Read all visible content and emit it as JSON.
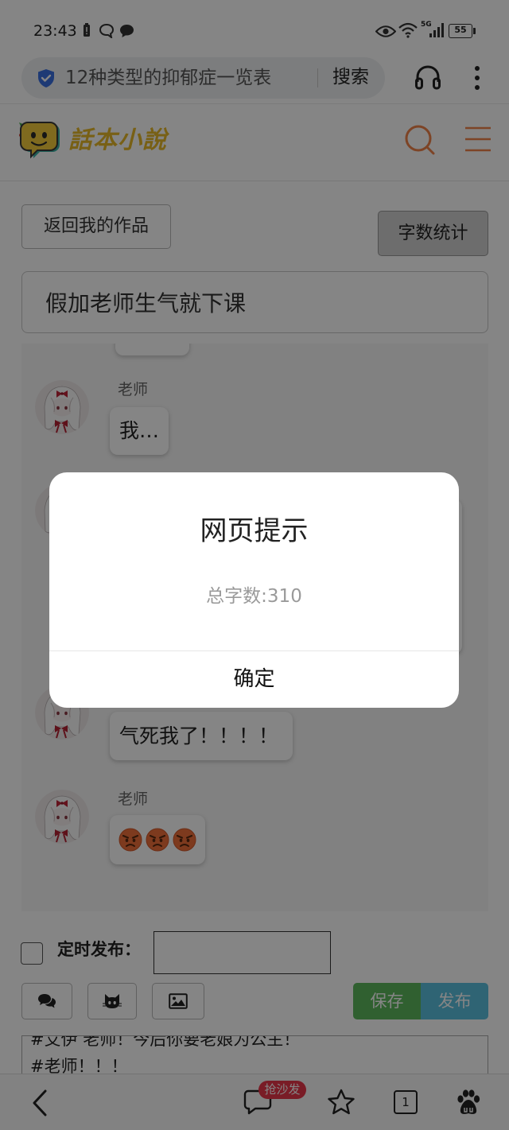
{
  "status_bar": {
    "time": "23:43",
    "network_label": "5G",
    "battery_level": "55",
    "icons": [
      "battery-alert-icon",
      "chat-outline-icon",
      "chat-filled-icon",
      "eye-icon",
      "wifi-icon",
      "cell-signal-icon",
      "battery-icon"
    ]
  },
  "browser": {
    "address_text": "12种类型的抑郁症一览表",
    "search_label": "搜索",
    "icons": [
      "shield-icon",
      "headphones-icon",
      "more-vertical-icon"
    ]
  },
  "site_header": {
    "logo_text": "話本小說",
    "icons": [
      "logo-mascot-icon",
      "search-icon",
      "menu-icon"
    ]
  },
  "editor": {
    "back_button_label": "返回我的作品",
    "word_count_button_label": "字数统计",
    "story_title": "假加老师生气就下课"
  },
  "chat": {
    "messages": [
      {
        "speaker": "老师",
        "text": "我…"
      },
      {
        "text": "气死我了！！！！"
      },
      {
        "speaker": "老师",
        "emoji": [
          "angry-face-icon",
          "angry-face-icon",
          "angry-face-icon"
        ]
      }
    ]
  },
  "schedule": {
    "label": "定时发布：",
    "checked": false,
    "value": ""
  },
  "toolbar": {
    "icons": [
      "comments-icon",
      "github-icon",
      "image-icon"
    ],
    "save_label": "保存",
    "publish_label": "发布"
  },
  "compose": {
    "lines": [
      "#艾伊 老师！今后你要老娘为公主！",
      "#老师！！！"
    ]
  },
  "bottom_nav": {
    "badge_label": "抢沙发",
    "tab_count": "1",
    "icons": [
      "back-icon",
      "comment-icon",
      "star-icon",
      "tabs-icon",
      "baidu-paw-icon"
    ]
  },
  "dialog": {
    "title": "网页提示",
    "message": "总字数:310",
    "confirm_label": "确定"
  },
  "theme": {
    "accent": "#f0834a",
    "save": "#5cb85c",
    "publish": "#5bc0de",
    "badge": "#e8374a",
    "link": "#3b6fe0",
    "backdrop": "rgba(0,0,0,0.48)"
  }
}
